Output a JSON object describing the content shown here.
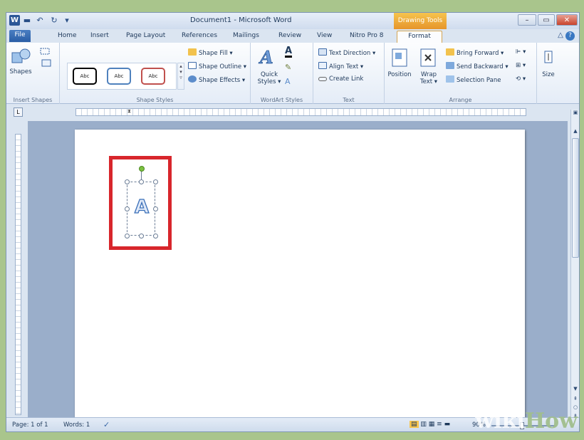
{
  "window": {
    "title": "Document1 - Microsoft Word",
    "context_tab": "Drawing Tools",
    "logo": "W",
    "quick_access": [
      "save-icon",
      "undo-icon",
      "redo-icon",
      "customize-icon"
    ],
    "controls": {
      "minimize": "–",
      "restore": "▭",
      "close": "✕"
    }
  },
  "tabs": [
    "File",
    "Home",
    "Insert",
    "Page Layout",
    "References",
    "Mailings",
    "Review",
    "View",
    "Nitro Pro 8",
    "Format"
  ],
  "active_tab": "Format",
  "ribbon": {
    "insert_shapes": {
      "label": "Insert Shapes",
      "shapes": "Shapes"
    },
    "shape_styles": {
      "label": "Shape Styles",
      "styles": [
        "Abc",
        "Abc",
        "Abc"
      ],
      "style_colors": [
        "#000000",
        "#4f81bd",
        "#c0504d"
      ],
      "fill": "Shape Fill",
      "outline": "Shape Outline",
      "effects": "Shape Effects"
    },
    "wordart_styles": {
      "label": "WordArt Styles",
      "quick_styles_1": "Quick",
      "quick_styles_2": "Styles"
    },
    "text": {
      "label": "Text",
      "direction": "Text Direction",
      "align": "Align Text",
      "link": "Create Link"
    },
    "arrange": {
      "label": "Arrange",
      "position": "Position",
      "wrap_1": "Wrap",
      "wrap_2": "Text",
      "bring_forward": "Bring Forward",
      "send_backward": "Send Backward",
      "selection_pane": "Selection Pane"
    },
    "size": {
      "label": "Size"
    }
  },
  "document": {
    "wordart_text": "A"
  },
  "statusbar": {
    "page": "Page: 1 of 1",
    "words": "Words: 1",
    "zoom": "90%"
  },
  "watermark": {
    "wiki": "wiki",
    "how": "How"
  }
}
